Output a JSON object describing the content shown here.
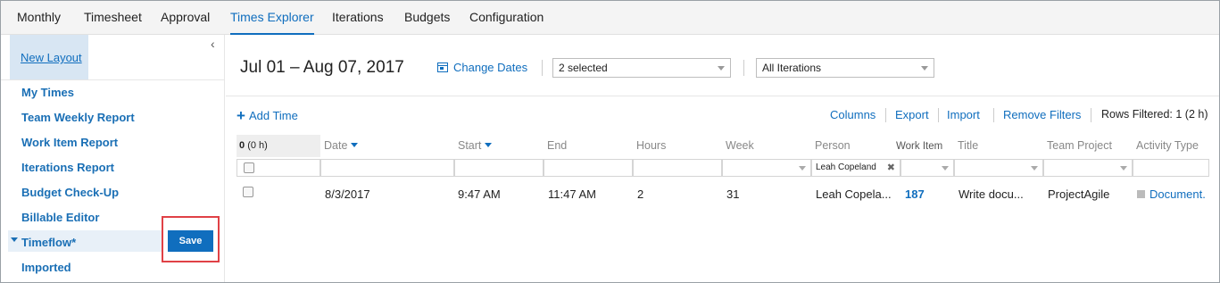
{
  "nav": {
    "tabs": [
      "Monthly",
      "Timesheet",
      "Approval",
      "Times Explorer",
      "Iterations",
      "Budgets",
      "Configuration"
    ],
    "active_tab": "Times Explorer"
  },
  "sidebar": {
    "new_layout": "New Layout",
    "collapse_icon": "‹",
    "items": [
      "My Times",
      "Team Weekly Report",
      "Work Item Report",
      "Iterations Report",
      "Budget Check-Up",
      "Billable Editor",
      "Timeflow*",
      "Imported"
    ],
    "save_label": "Save"
  },
  "header": {
    "date_range": "Jul 01 – Aug 07, 2017",
    "change_dates": "Change Dates",
    "selected_filter": "2 selected",
    "iterations_filter": "All Iterations"
  },
  "toolbar": {
    "add_time": "Add Time",
    "plus_icon": "+",
    "columns": "Columns",
    "export": "Export",
    "import": "Import",
    "remove_filters": "Remove Filters",
    "rows_filtered": "Rows Filtered: 1 (2 h)"
  },
  "grid": {
    "total_count": "0",
    "total_hours": "(0 h)",
    "columns": [
      "Date",
      "Start",
      "End",
      "Hours",
      "Week",
      "Person",
      "Work Item",
      "Title",
      "Team Project",
      "Activity Type"
    ],
    "person_filter": "Leah Copeland",
    "clear_icon": "✖",
    "rows": [
      {
        "date": "8/3/2017",
        "start": "9:47 AM",
        "end": "11:47 AM",
        "hours": "2",
        "week": "31",
        "person": "Leah Copela...",
        "work_item": "187",
        "title": "Write docu...",
        "team_project": "ProjectAgile",
        "activity_type": "Document."
      }
    ]
  },
  "colors": {
    "accent": "#106ebe",
    "save_outline": "#e04146"
  }
}
